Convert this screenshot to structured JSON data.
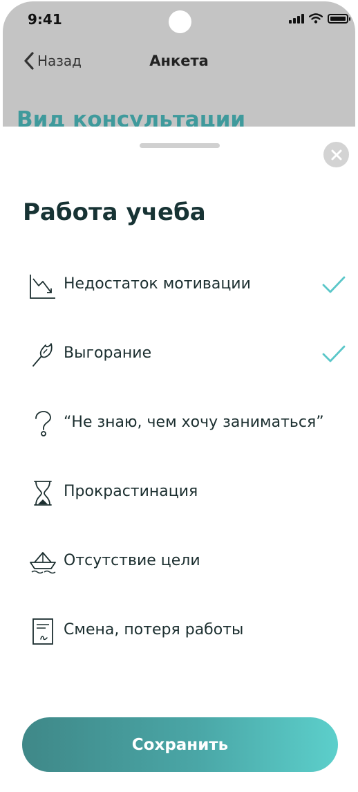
{
  "status_bar": {
    "time": "9:41"
  },
  "nav": {
    "back_label": "Назад",
    "title": "Анкета"
  },
  "background": {
    "peek_title": "Вид консультации"
  },
  "sheet": {
    "title": "Работа учеба",
    "options": [
      {
        "label": "Недостаток мотивации",
        "icon": "chart-down-icon",
        "checked": true
      },
      {
        "label": "Выгорание",
        "icon": "burned-match-icon",
        "checked": true
      },
      {
        "label": "“Не знаю, чем хочу заниматься”",
        "icon": "question-icon",
        "checked": false
      },
      {
        "label": "Прокрастинация",
        "icon": "hourglass-icon",
        "checked": false
      },
      {
        "label": "Отсутствие цели",
        "icon": "paper-boat-icon",
        "checked": false
      },
      {
        "label": "Смена, потеря работы",
        "icon": "document-icon",
        "checked": false
      }
    ],
    "save_label": "Сохранить"
  },
  "colors": {
    "accent": "#5bc7c9",
    "title": "#173334",
    "backdrop": "#c4c4c4",
    "button_gradient": [
      "#3f8888",
      "#5ccfcb"
    ]
  }
}
